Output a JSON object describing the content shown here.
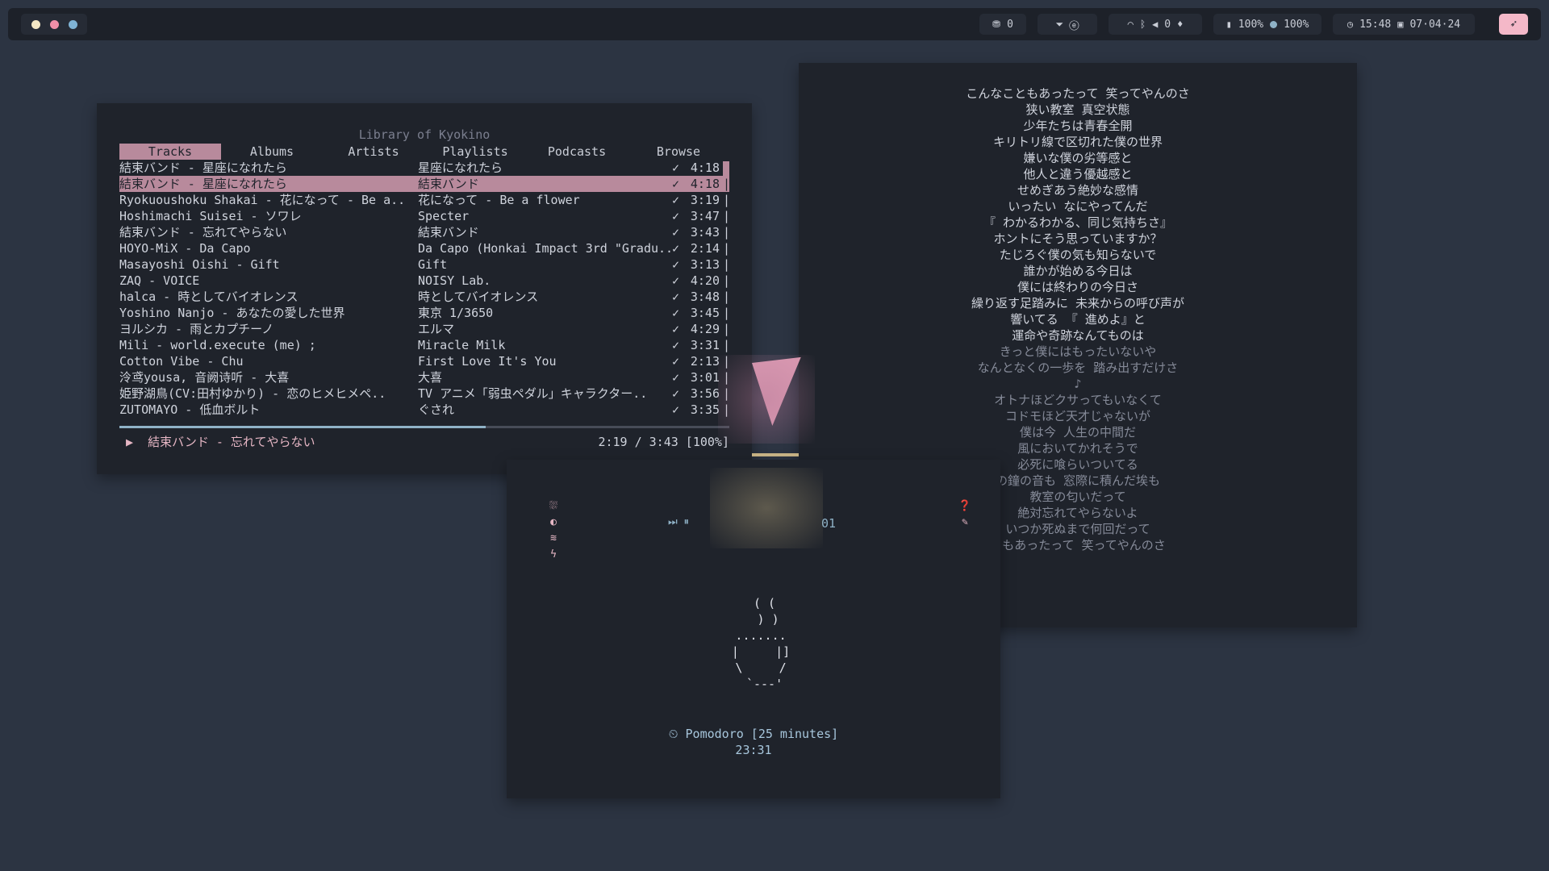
{
  "topbar": {
    "workspace_colors": [
      "#f3e6c4",
      "#f08fa8",
      "#7fb3d5"
    ],
    "updates": "0",
    "tray": "⏷  ⓔ",
    "net": "0",
    "battery1": "100%",
    "battery2": "100%",
    "time": "15:48",
    "date": "07·04·24"
  },
  "cmus": {
    "title": "Library of Kyokino",
    "tabs": [
      "Tracks",
      "Albums",
      "Artists",
      "Playlists",
      "Podcasts",
      "Browse"
    ],
    "tracks": [
      {
        "name": "結束バンド - 星座になれたら",
        "album": "星座になれたら",
        "dur": "4:18"
      },
      {
        "name": "結束バンド - 星座になれたら",
        "album": "結束バンド",
        "dur": "4:18"
      },
      {
        "name": "Ryokuoushoku Shakai - 花になって - Be a..",
        "album": "花になって - Be a flower",
        "dur": "3:19"
      },
      {
        "name": "Hoshimachi Suisei - ソワレ",
        "album": "Specter",
        "dur": "3:47"
      },
      {
        "name": "結束バンド - 忘れてやらない",
        "album": "結束バンド",
        "dur": "3:43"
      },
      {
        "name": "HOYO-MiX - Da Capo",
        "album": "Da Capo (Honkai Impact 3rd \"Gradu..",
        "dur": "2:14"
      },
      {
        "name": "Masayoshi Oishi - Gift",
        "album": "Gift",
        "dur": "3:13"
      },
      {
        "name": "ZAQ - VOICE",
        "album": "NOISY Lab.",
        "dur": "4:20"
      },
      {
        "name": "halca - 時としてバイオレンス",
        "album": "時としてバイオレンス",
        "dur": "3:48"
      },
      {
        "name": "Yoshino Nanjo - あなたの愛した世界",
        "album": "東京 1/3650",
        "dur": "3:45"
      },
      {
        "name": "ヨルシカ - 雨とカプチーノ",
        "album": "エルマ",
        "dur": "4:29"
      },
      {
        "name": "Mili - world.execute (me) ;",
        "album": "Miracle Milk",
        "dur": "3:31"
      },
      {
        "name": "Cotton Vibe - Chu",
        "album": "First Love It's You",
        "dur": "2:13"
      },
      {
        "name": "泠鸢yousa, 音阙诗听 - 大喜",
        "album": "大喜",
        "dur": "3:01"
      },
      {
        "name": "姫野湖鳥(CV:田村ゆかり) - 恋のヒメヒメペ..",
        "album": "TV アニメ「弱虫ペダル」キャラクター..",
        "dur": "3:56"
      },
      {
        "name": "ZUTOMAYO - 低血ボルト",
        "album": "ぐされ",
        "dur": "3:35"
      }
    ],
    "check": "✓",
    "bar": "|",
    "progress": 0.6,
    "now_playing": "▶  結束バンド - 忘れてやらない",
    "position": "2:19 / 3:43 [100%]"
  },
  "lyrics": [
    "こんなこともあったって 笑ってやんのさ",
    "狭い教室 真空状態",
    "少年たちは青春全開",
    "キリトリ線で区切れた僕の世界",
    "嫌いな僕の劣等感と",
    "他人と違う優越感と",
    "せめぎあう絶妙な感情",
    "いったい なにやってんだ",
    "『 わかるわかる、同じ気持ちさ』",
    "ホントにそう思っていますか？",
    "たじろぐ僕の気も知らないで",
    "誰かが始める今日は",
    "僕には終わりの今日さ",
    "繰り返す足踏みに 未来からの呼び声が",
    "響いてる 『 進めよ』と",
    "運命や奇跡なんてものは",
    "きっと僕にはもったいないや",
    "なんとなくの一歩を 踏み出すだけさ",
    "♪",
    "オトナほどクサってもいなくて",
    "コドモほど天才じゃないが",
    "僕は今 人生の中間だ",
    "風においてかれそうで",
    "必死に喰らいついてる",
    "の鐘の音も 窓際に積んだ埃も",
    "教室の匂いだって",
    "絶対忘れてやらないよ",
    "いつか死ぬまで何回だって",
    "ともあったって 笑ってやんのさ"
  ],
  "lyrics_dim_from": 16,
  "clock": {
    "left_icons": [
      "⛆",
      "◐",
      "≋",
      "ϟ"
    ],
    "right_icons": [
      "❓",
      "✎"
    ],
    "media": "⏭ ⏸",
    "track_no": "01",
    "ascii": "   ( (\n    ) )\n  .......\n  |     |]\n  \\     /\n   `---'",
    "pomodoro": "⏲ Pomodoro [25 minutes]",
    "timer": "23:31"
  }
}
